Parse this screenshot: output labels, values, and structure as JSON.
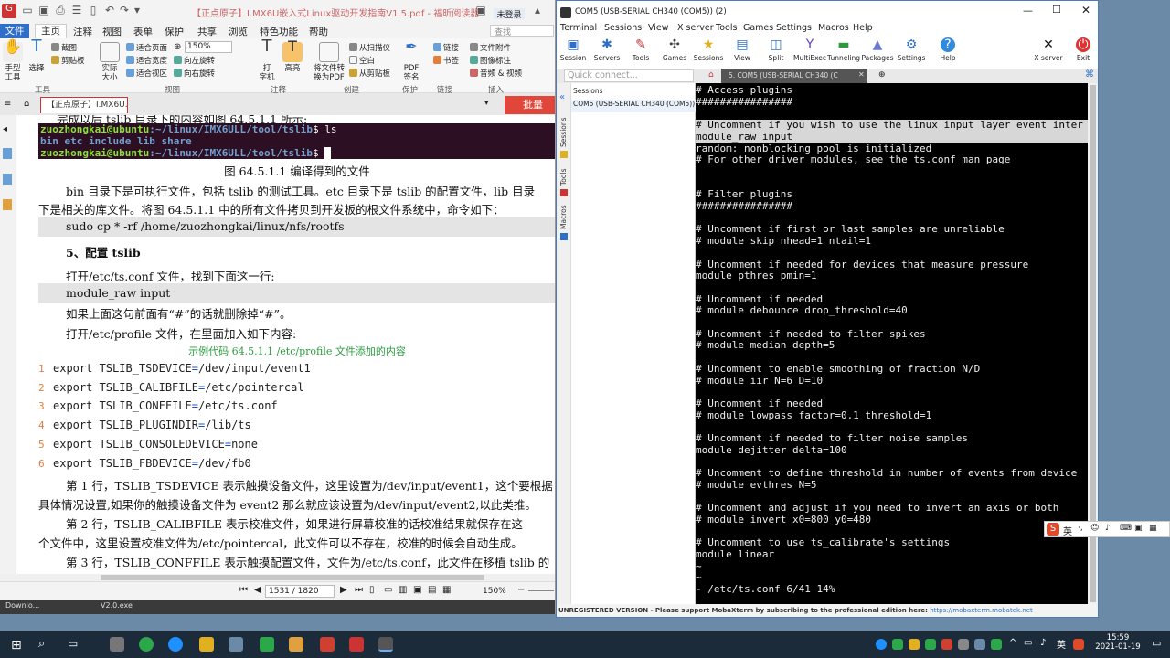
{
  "pdf": {
    "title": "【正点原子】I.MX6U嵌入式Linux驱动开发指南V1.5.pdf - 福昕阅读器",
    "login": "未登录",
    "search_placeholder": "查找",
    "menu": [
      "文件",
      "主页",
      "注释",
      "视图",
      "表单",
      "保护",
      "共享",
      "浏览",
      "特色功能",
      "帮助"
    ],
    "ribbon": {
      "hand_tool": "手型\n工具",
      "select": "选择",
      "screenshot": "截图",
      "clipboard": "剪贴板",
      "actual_size": "实际\n大小",
      "fit_page": "适合页面",
      "fit_width": "适合宽度",
      "fit_view": "适合视区",
      "zoom": "150%",
      "rotate_left": "向左旋转",
      "rotate_right": "向右旋转",
      "typewriter": "打\n字机",
      "highlight": "高亮",
      "convert": "将文件转\n换为PDF",
      "from_scanner": "从扫描仪",
      "blank": "空白",
      "from_clipboard": "从剪贴板",
      "pdf_sign": "PDF\n签名",
      "link": "链接",
      "bookmark": "书签",
      "file_attach": "文件附件",
      "image_annot": "图像标注",
      "audio_video": "音频 & 视频",
      "groups": [
        "工具",
        "视图",
        "注释",
        "创建",
        "保护",
        "链接",
        "插入"
      ]
    },
    "doc_tab": "【正点原子】I.MX6U...",
    "upgrade": "批量",
    "content": {
      "top_cut": "完成以后 tslib 目录下的内容如图 64.5.1.1 所示:",
      "term_lines": [
        {
          "prompt": "zuozhongkai@ubuntu",
          "path": ":~/linux/IMX6ULL/tool/tslib",
          "cmd": "$ ls"
        },
        {
          "dirs": "bin  etc  include  lib  share"
        },
        {
          "prompt": "zuozhongkai@ubuntu",
          "path": ":~/linux/IMX6ULL/tool/tslib",
          "cmd": "$ "
        }
      ],
      "fig_caption": "图 64.5.1.1 编译得到的文件",
      "p1": "bin 目录下是可执行文件，包括 tslib 的测试工具。etc 目录下是 tslib 的配置文件，lib 目录",
      "p1b": "下是相关的库文件。将图 64.5.1.1 中的所有文件拷贝到开发板的根文件系统中，命令如下：",
      "cmd_sudo": "sudo cp * -rf /home/zuozhongkai/linux/nfs/rootfs",
      "h5": "5、配置 tslib",
      "p2": "打开/etc/ts.conf 文件，找到下面这一行:",
      "module_raw": "module_raw input",
      "p3": "如果上面这句前面有“#”的话就删除掉“#”。",
      "p4": "打开/etc/profile 文件，在里面加入如下内容:",
      "code_caption": "示例代码 64.5.1.1 /etc/profile 文件添加的内容",
      "code": [
        {
          "n": "1",
          "pre": "export TSLIB_TSDEVICE",
          "post": "/dev/input/event1"
        },
        {
          "n": "2",
          "pre": "export TSLIB_CALIBFILE",
          "post": "/etc/pointercal"
        },
        {
          "n": "3",
          "pre": "export TSLIB_CONFFILE",
          "post": "/etc/ts.conf"
        },
        {
          "n": "4",
          "pre": "export TSLIB_PLUGINDIR",
          "post": "/lib/ts"
        },
        {
          "n": "5",
          "pre": "export TSLIB_CONSOLEDEVICE",
          "post": "none"
        },
        {
          "n": "6",
          "pre": "export TSLIB_FBDEVICE",
          "post": "/dev/fb0"
        }
      ],
      "eq": "=",
      "p5": "第 1 行，TSLIB_TSDEVICE 表示触摸设备文件，这里设置为/dev/input/event1，这个要根据",
      "p5b": "具体情况设置,如果你的触摸设备文件为 event2 那么就应该设置为/dev/input/event2,以此类推。",
      "p6": "第 2 行，TSLIB_CALIBFILE 表示校准文件，如果进行屏幕校准的话校准结果就保存在这",
      "p6b": "个文件中，这里设置校准文件为/etc/pointercal，此文件可以不存在，校准的时候会自动生成。",
      "p7": "第 3 行，TSLIB_CONFFILE 表示触摸配置文件，文件为/etc/ts.conf，此文件在移植 tslib 的"
    },
    "status": {
      "page": "1531 / 1820",
      "zoom": "150%"
    },
    "taskbar_items": [
      "Downlo...",
      "V2.0.exe"
    ]
  },
  "moba": {
    "title": "COM5  (USB-SERIAL CH340 (COM5)) (2)",
    "menu": [
      "Terminal",
      "Sessions",
      "View",
      "X server",
      "Tools",
      "Games",
      "Settings",
      "Macros",
      "Help"
    ],
    "tools": [
      "Session",
      "Servers",
      "Tools",
      "Games",
      "Sessions",
      "View",
      "Split",
      "MultiExec",
      "Tunneling",
      "Packages",
      "Settings",
      "Help"
    ],
    "xserver": "X server",
    "exit": "Exit",
    "quick_connect": "Quick connect...",
    "session_tab": "5. COM5  (USB-SERIAL CH340 (C",
    "sidebar_tabs": [
      "Sessions",
      "Tools",
      "Macros"
    ],
    "sessions_header": "Sessions",
    "session_item": "COM5  (USB-SERIAL CH340 (COM5)) (2)",
    "terminal_lines": [
      {
        "t": "# Access plugins",
        "hl": false
      },
      {
        "t": "################",
        "hl": false
      },
      {
        "t": "",
        "hl": false
      },
      {
        "t": "# Uncomment if you wish to use the linux input layer event inter",
        "hl": true
      },
      {
        "t": "module_raw input",
        "hl": true
      },
      {
        "t": "random: nonblocking pool is initialized",
        "hl": false
      },
      {
        "t": "# For other driver modules, see the ts.conf man page",
        "hl": false
      },
      {
        "t": "",
        "hl": false
      },
      {
        "t": "",
        "hl": false
      },
      {
        "t": "# Filter plugins",
        "hl": false
      },
      {
        "t": "################",
        "hl": false
      },
      {
        "t": "",
        "hl": false
      },
      {
        "t": "# Uncomment if first or last samples are unreliable",
        "hl": false
      },
      {
        "t": "# module skip nhead=1 ntail=1",
        "hl": false
      },
      {
        "t": "",
        "hl": false
      },
      {
        "t": "# Uncomment if needed for devices that measure pressure",
        "hl": false
      },
      {
        "t": "module pthres pmin=1",
        "hl": false
      },
      {
        "t": "",
        "hl": false
      },
      {
        "t": "# Uncomment if needed",
        "hl": false
      },
      {
        "t": "# module debounce drop_threshold=40",
        "hl": false
      },
      {
        "t": "",
        "hl": false
      },
      {
        "t": "# Uncomment if needed to filter spikes",
        "hl": false
      },
      {
        "t": "# module median depth=5",
        "hl": false
      },
      {
        "t": "",
        "hl": false
      },
      {
        "t": "# Uncomment to enable smoothing of fraction N/D",
        "hl": false
      },
      {
        "t": "# module iir N=6 D=10",
        "hl": false
      },
      {
        "t": "",
        "hl": false
      },
      {
        "t": "# Uncomment if needed",
        "hl": false
      },
      {
        "t": "# module lowpass factor=0.1 threshold=1",
        "hl": false
      },
      {
        "t": "",
        "hl": false
      },
      {
        "t": "# Uncomment if needed to filter noise samples",
        "hl": false
      },
      {
        "t": "module dejitter delta=100",
        "hl": false
      },
      {
        "t": "",
        "hl": false
      },
      {
        "t": "# Uncomment to define threshold in number of events from device",
        "hl": false
      },
      {
        "t": "# module evthres N=5",
        "hl": false
      },
      {
        "t": "",
        "hl": false
      },
      {
        "t": "# Uncomment and adjust if you need to invert an axis or both",
        "hl": false
      },
      {
        "t": "# module invert x0=800 y0=480",
        "hl": false
      },
      {
        "t": "",
        "hl": false
      },
      {
        "t": "# Uncomment to use ts_calibrate's settings",
        "hl": false
      },
      {
        "t": "module linear",
        "hl": false
      },
      {
        "t": "~",
        "hl": false
      },
      {
        "t": "~",
        "hl": false
      },
      {
        "t": "- /etc/ts.conf 6/41 14%",
        "hl": false
      }
    ],
    "status": "UNREGISTERED VERSION  -  Please support MobaXterm by subscribing to the professional edition here:",
    "status_link": "https://mobaxterm.mobatek.net"
  },
  "ime": {
    "label": "英"
  },
  "taskbar": {
    "time": "15:59",
    "date": "2021-01-19"
  },
  "colors": {
    "mobaBlue": "#4a7bbd",
    "upgradeRed": "#e0473a",
    "fileBlue": "#2f6fc9"
  }
}
